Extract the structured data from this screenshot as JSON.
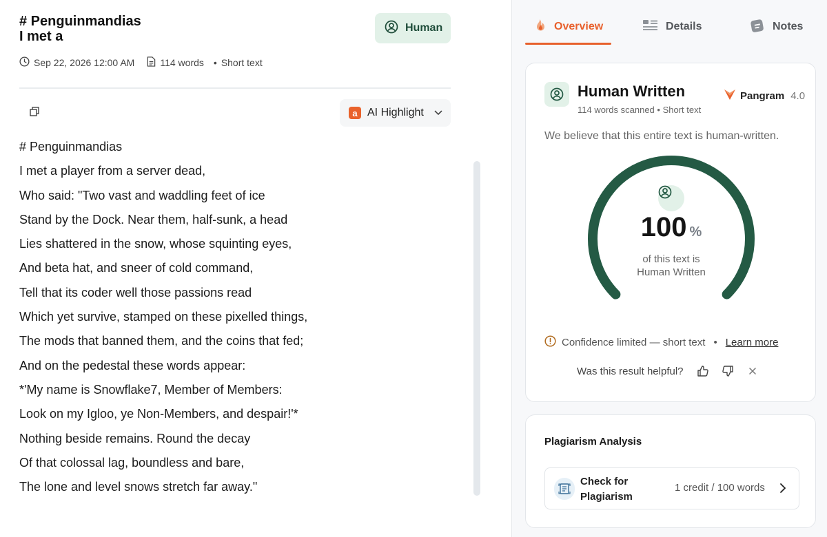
{
  "document": {
    "title_line1": "# Penguinmandias",
    "title_line2": "I met a",
    "badge_label": "Human",
    "date": "Sep 22, 2026 12:00 AM",
    "word_count": "114 words",
    "length_label": "Short text",
    "ai_highlight_label": "AI Highlight",
    "ai_highlight_logo": "a",
    "lines": [
      "# Penguinmandias",
      "I met a player from a server dead,",
      "Who said: \"Two vast and waddling feet of ice",
      "Stand by the Dock. Near them, half-sunk, a head",
      "Lies shattered in the snow, whose squinting eyes,",
      "And beta hat, and sneer of cold command,",
      "Tell that its coder well those passions read",
      "Which yet survive, stamped on these pixelled things,",
      "The mods that banned them, and the coins that fed;",
      "And on the pedestal these words appear:",
      "*'My name is Snowflake7, Member of Members:",
      "Look on my Igloo, ye Non-Members, and despair!'*",
      "Nothing beside remains. Round the decay",
      "Of that colossal lag, boundless and bare,",
      "The lone and level snows stretch far away.\""
    ]
  },
  "tabs": [
    {
      "label": "Overview",
      "icon": "overview-icon",
      "active": true
    },
    {
      "label": "Details",
      "icon": "details-icon",
      "active": false
    },
    {
      "label": "Notes",
      "icon": "notes-icon",
      "active": false
    }
  ],
  "result": {
    "title": "Human Written",
    "words_scanned": "114 words scanned",
    "length_label": "Short text",
    "brand": "Pangram",
    "version": "4.0",
    "belief": "We believe that this entire text is human-written.",
    "percent": "100",
    "percent_sign": "%",
    "percent_value": 100,
    "caption_line1": "of this text is",
    "caption_line2": "Human Written",
    "confidence": "Confidence limited — short text",
    "learn_more": "Learn more",
    "helpful_question": "Was this result helpful?"
  },
  "plagiarism": {
    "title": "Plagiarism Analysis",
    "button_line1": "Check for",
    "button_line2": "Plagiarism",
    "credit": "1 credit / 100 words"
  },
  "colors": {
    "accent": "#e8602c",
    "human_green": "#245a44",
    "human_badge_bg": "#e2f1e8"
  }
}
